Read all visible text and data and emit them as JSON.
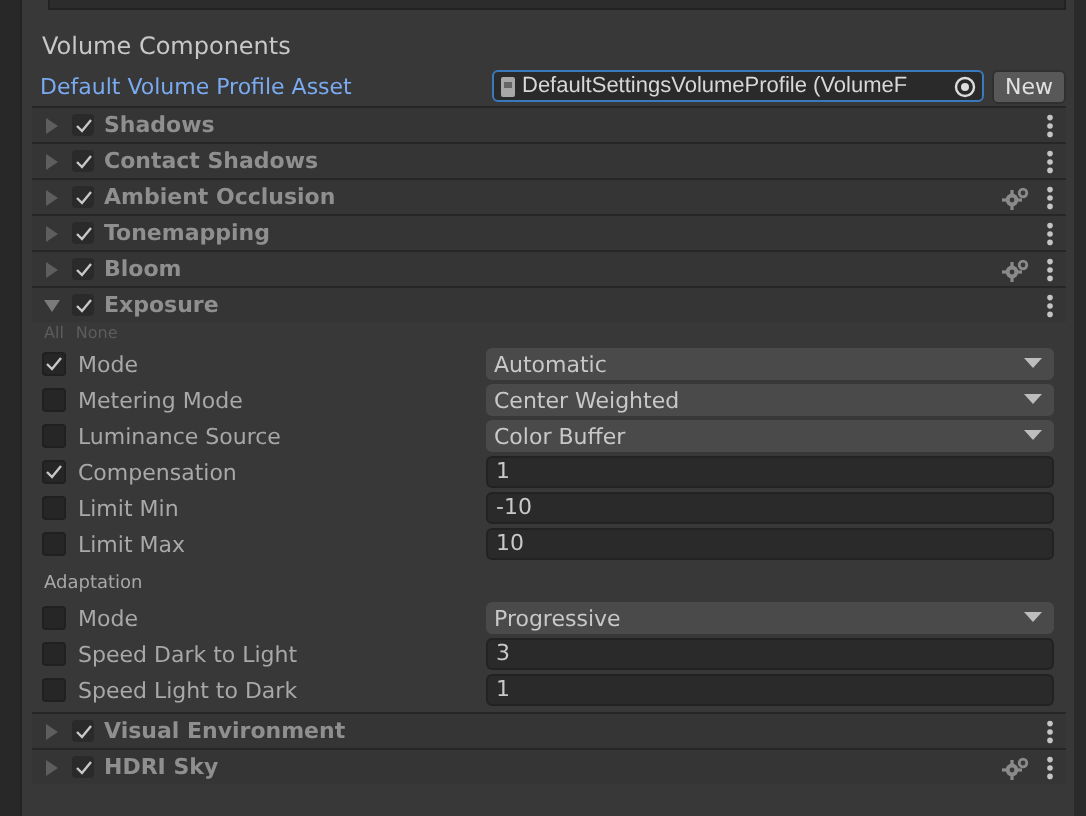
{
  "section_title": "Volume Components",
  "profile": {
    "label": "Default Volume Profile Asset",
    "value": "DefaultSettingsVolumeProfile (VolumeF",
    "button": "New"
  },
  "components": [
    {
      "name": "Shadows",
      "enabled": true,
      "expanded": false,
      "gear_icon": false
    },
    {
      "name": "Contact Shadows",
      "enabled": true,
      "expanded": false,
      "gear_icon": false
    },
    {
      "name": "Ambient Occlusion",
      "enabled": true,
      "expanded": false,
      "gear_icon": true
    },
    {
      "name": "Tonemapping",
      "enabled": true,
      "expanded": false,
      "gear_icon": false
    },
    {
      "name": "Bloom",
      "enabled": true,
      "expanded": false,
      "gear_icon": true
    },
    {
      "name": "Exposure",
      "enabled": true,
      "expanded": true,
      "gear_icon": false,
      "toggles": [
        "All",
        "None"
      ],
      "groups": [
        {
          "properties": [
            {
              "label": "Mode",
              "overridden": true,
              "kind": "dropdown",
              "value": "Automatic"
            },
            {
              "label": "Metering Mode",
              "overridden": false,
              "kind": "dropdown",
              "value": "Center Weighted"
            },
            {
              "label": "Luminance Source",
              "overridden": false,
              "kind": "dropdown",
              "value": "Color Buffer"
            },
            {
              "label": "Compensation",
              "overridden": true,
              "kind": "field",
              "value": "1"
            },
            {
              "label": "Limit Min",
              "overridden": false,
              "kind": "field",
              "value": "-10"
            },
            {
              "label": "Limit Max",
              "overridden": false,
              "kind": "field",
              "value": "10"
            }
          ]
        },
        {
          "header": "Adaptation",
          "properties": [
            {
              "label": "Mode",
              "overridden": false,
              "kind": "dropdown",
              "value": "Progressive"
            },
            {
              "label": "Speed Dark to Light",
              "overridden": false,
              "kind": "field",
              "value": "3"
            },
            {
              "label": "Speed Light to Dark",
              "overridden": false,
              "kind": "field",
              "value": "1"
            }
          ]
        }
      ]
    },
    {
      "name": "Visual Environment",
      "enabled": true,
      "expanded": false,
      "gear_icon": false
    },
    {
      "name": "HDRI Sky",
      "enabled": true,
      "expanded": false,
      "gear_icon": true
    }
  ]
}
